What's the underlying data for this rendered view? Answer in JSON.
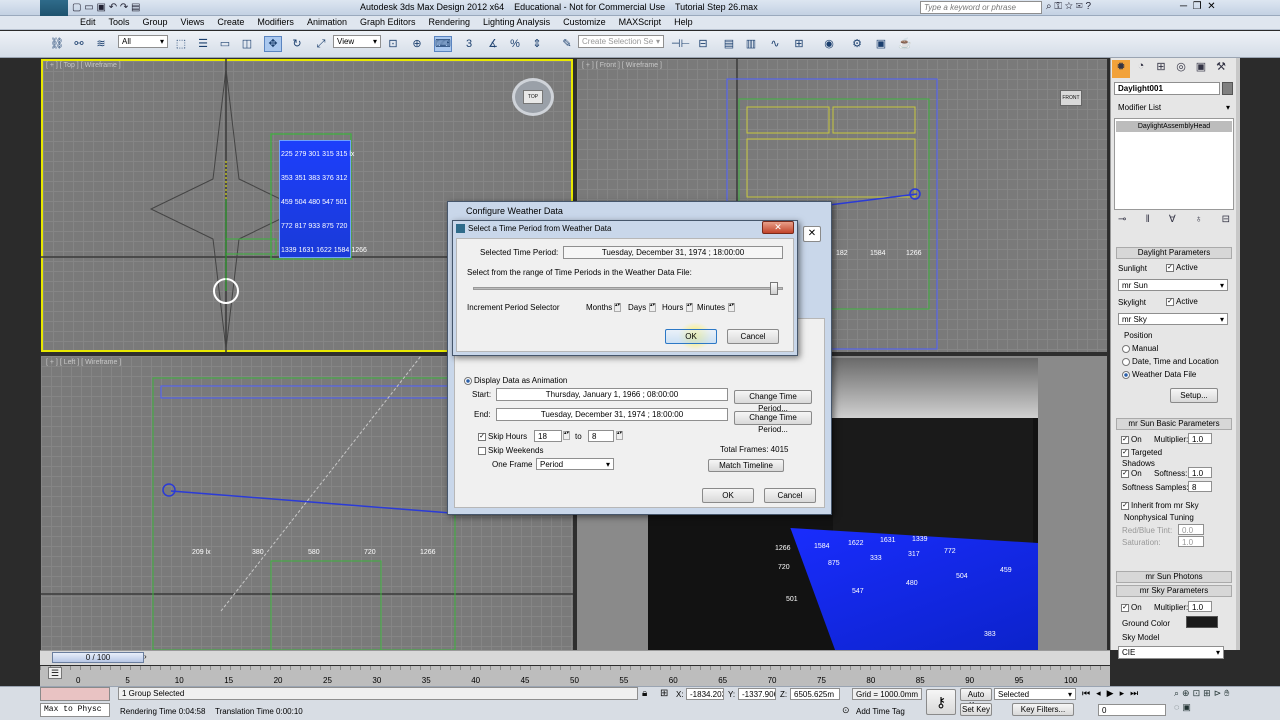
{
  "titlebar": {
    "title": "Autodesk 3ds Max Design 2012 x64    Educational - Not for Commercial Use    Tutorial Step 26.max",
    "search_placeholder": "Type a keyword or phrase",
    "app_badge": "3DS"
  },
  "menu": [
    "Edit",
    "Tools",
    "Group",
    "Views",
    "Create",
    "Modifiers",
    "Animation",
    "Graph Editors",
    "Rendering",
    "Lighting Analysis",
    "Customize",
    "MAXScript",
    "Help"
  ],
  "toolbar": {
    "filter": "All",
    "view": "View",
    "selection_set_placeholder": "Create Selection Se",
    "snap_label": "3",
    "angle_label": "%"
  },
  "viewports": {
    "top": "[ + ] [ Top ] [ Wireframe ]",
    "front": "[ + ] [ Front ] [ Wireframe ]",
    "left": "[ + ] [ Left ] [ Wireframe ]",
    "viewcube_top": "TOP",
    "viewcube_front": "FRONT"
  },
  "top_grid_values": [
    [
      "225",
      "279",
      "301",
      "315",
      "315 lx"
    ],
    [
      "353",
      "351",
      "383",
      "376",
      "312"
    ],
    [
      "459",
      "504",
      "480",
      "547",
      "501"
    ],
    [
      "772",
      "817",
      "933",
      "875",
      "720"
    ],
    [
      "1339",
      "1631",
      "1622",
      "1584",
      "1266"
    ]
  ],
  "front_values": [
    "182",
    "1584",
    "1266"
  ],
  "left_values": [
    "209 lx",
    "380",
    "580",
    "720",
    "1266"
  ],
  "render_values": [
    "1266",
    "1584",
    "1622",
    "1631",
    "1339",
    "720",
    "875",
    "333",
    "317",
    "772",
    "480",
    "504",
    "459",
    "501",
    "547",
    "383"
  ],
  "configure_dialog": {
    "title": "Configure Weather Data",
    "display_label": "Display Data as  Animation",
    "start_label": "Start:",
    "start_value": "Thursday, January 1, 1966 ; 08:00:00",
    "end_label": "End:",
    "end_value": "Tuesday, December 31, 1974 ; 18:00:00",
    "change_start": "Change Time Period...",
    "change_end": "Change Time Period...",
    "skip_hours": "Skip Hours",
    "skip_from": "18",
    "skip_to_label": "to",
    "skip_to": "8",
    "skip_weekends": "Skip Weekends",
    "one_frame": "One Frame",
    "one_frame_value": "Period",
    "total_frames": "Total Frames:  4015",
    "match_timeline": "Match Timeline",
    "ok": "OK",
    "cancel": "Cancel"
  },
  "period_dialog": {
    "title": "Select a Time Period from Weather Data",
    "selected_label": "Selected Time Period:",
    "selected_value": "Tuesday, December 31, 1974 ; 18:00:00",
    "range_label": "Select from the range of Time Periods in the Weather Data File:",
    "increment_label": "Increment Period Selector",
    "months": "Months",
    "days": "Days",
    "hours": "Hours",
    "minutes": "Minutes",
    "slider_fraction": 0.97,
    "ok": "OK",
    "cancel": "Cancel"
  },
  "command_panel": {
    "object_name": "Daylight001",
    "modifier_list": "Modifier List",
    "stack_item": "DaylightAssemblyHead",
    "daylight": {
      "header": "Daylight Parameters",
      "sunlight": "Sunlight",
      "active": "Active",
      "sun_type": "mr Sun",
      "skylight": "Skylight",
      "sky_type": "mr Sky",
      "position": "Position",
      "manual": "Manual",
      "date_time": "Date, Time and Location",
      "weather": "Weather Data File",
      "setup": "Setup..."
    },
    "sun_basic": {
      "header": "mr Sun Basic Parameters",
      "on": "On",
      "multiplier": "Multiplier:",
      "mult_value": "1.0",
      "targeted": "Targeted",
      "shadows": "Shadows",
      "on2": "On",
      "softness": "Softness:",
      "soft_value": "1.0",
      "soft_samples": "Softness Samples:",
      "samples_value": "8",
      "inherit": "Inherit from mr Sky",
      "nonphys": "Nonphysical Tuning",
      "redblue": "Red/Blue Tint:",
      "redblue_value": "0.0",
      "saturation": "Saturation:",
      "sat_value": "1.0"
    },
    "sun_photons": "mr Sun Photons",
    "sky": {
      "header": "mr Sky Parameters",
      "on": "On",
      "multiplier": "Multiplier:",
      "mult_value": "1.0",
      "ground_color": "Ground Color",
      "sky_model": "Sky Model",
      "sky_model_value": "CIE",
      "ground_hex": "#1a1a1a"
    }
  },
  "timeline": {
    "frame": "0 / 100",
    "ticks": [
      "0",
      "5",
      "10",
      "15",
      "20",
      "25",
      "30",
      "35",
      "40",
      "45",
      "50",
      "55",
      "60",
      "65",
      "70",
      "75",
      "80",
      "85",
      "90",
      "95",
      "100"
    ]
  },
  "status": {
    "script": "Max to Physc",
    "selection": "1 Group Selected",
    "render_time": "Rendering Time  0:04:58",
    "translation_time": "Translation Time  0:00:10",
    "x": "-1834.203",
    "y": "-1337.906",
    "z": "6505.625m",
    "grid": "Grid = 1000.0mm",
    "add_time_tag": "Add Time Tag",
    "auto_key": "Auto Key",
    "set_key": "Set Key",
    "selected": "Selected",
    "key_filters": "Key Filters...",
    "frame_field": "0"
  },
  "colors": {
    "accent_yellow": "#e8e800",
    "sky_blue": "#1a3cff"
  }
}
